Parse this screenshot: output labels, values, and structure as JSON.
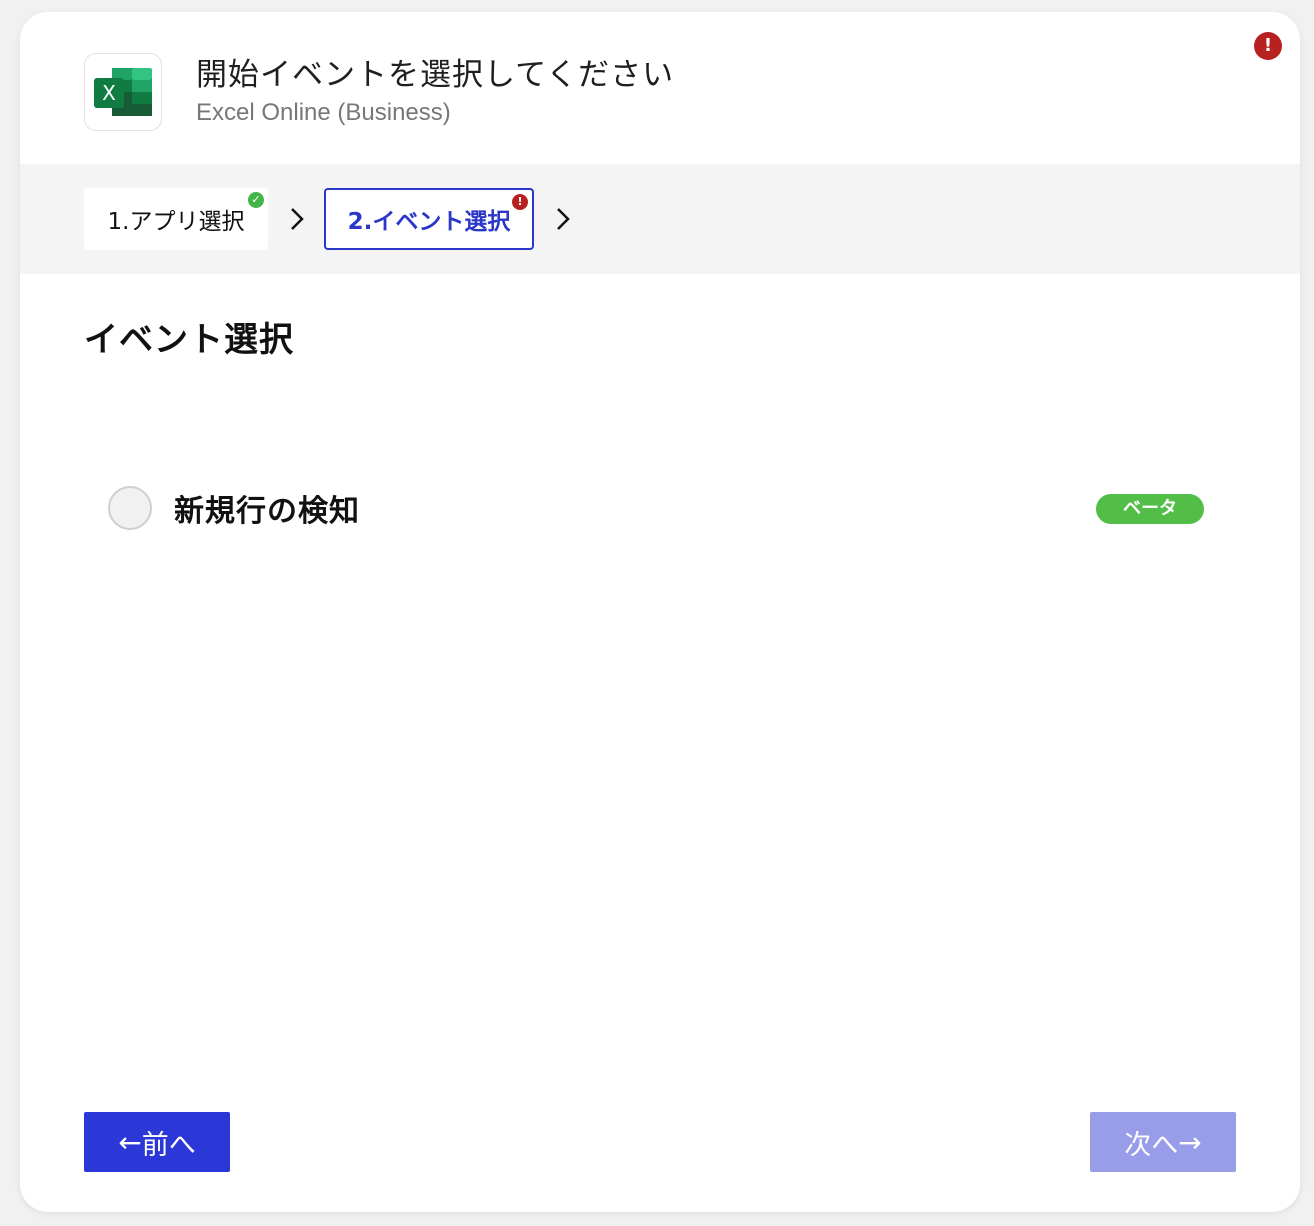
{
  "header": {
    "title": "開始イベントを選択してください",
    "subtitle": "Excel Online (Business)",
    "logo_icon": "excel-logo-icon"
  },
  "alert_icon": "exclamation-icon",
  "steps": [
    {
      "label": "1.アプリ選択",
      "status": "complete",
      "status_icon": "check-icon"
    },
    {
      "label": "2.イベント選択",
      "status": "error",
      "status_icon": "exclamation-icon"
    }
  ],
  "section": {
    "title": "イベント選択"
  },
  "options": [
    {
      "label": "新規行の検知",
      "badge": "ベータ",
      "selected": false
    }
  ],
  "buttons": {
    "prev_arrow": "←",
    "prev_label": "前へ",
    "next_label": "次へ",
    "next_arrow": "→"
  },
  "colors": {
    "primary": "#2b37d6",
    "primary_disabled": "#979de8",
    "success": "#52be47",
    "error": "#b7211f"
  }
}
